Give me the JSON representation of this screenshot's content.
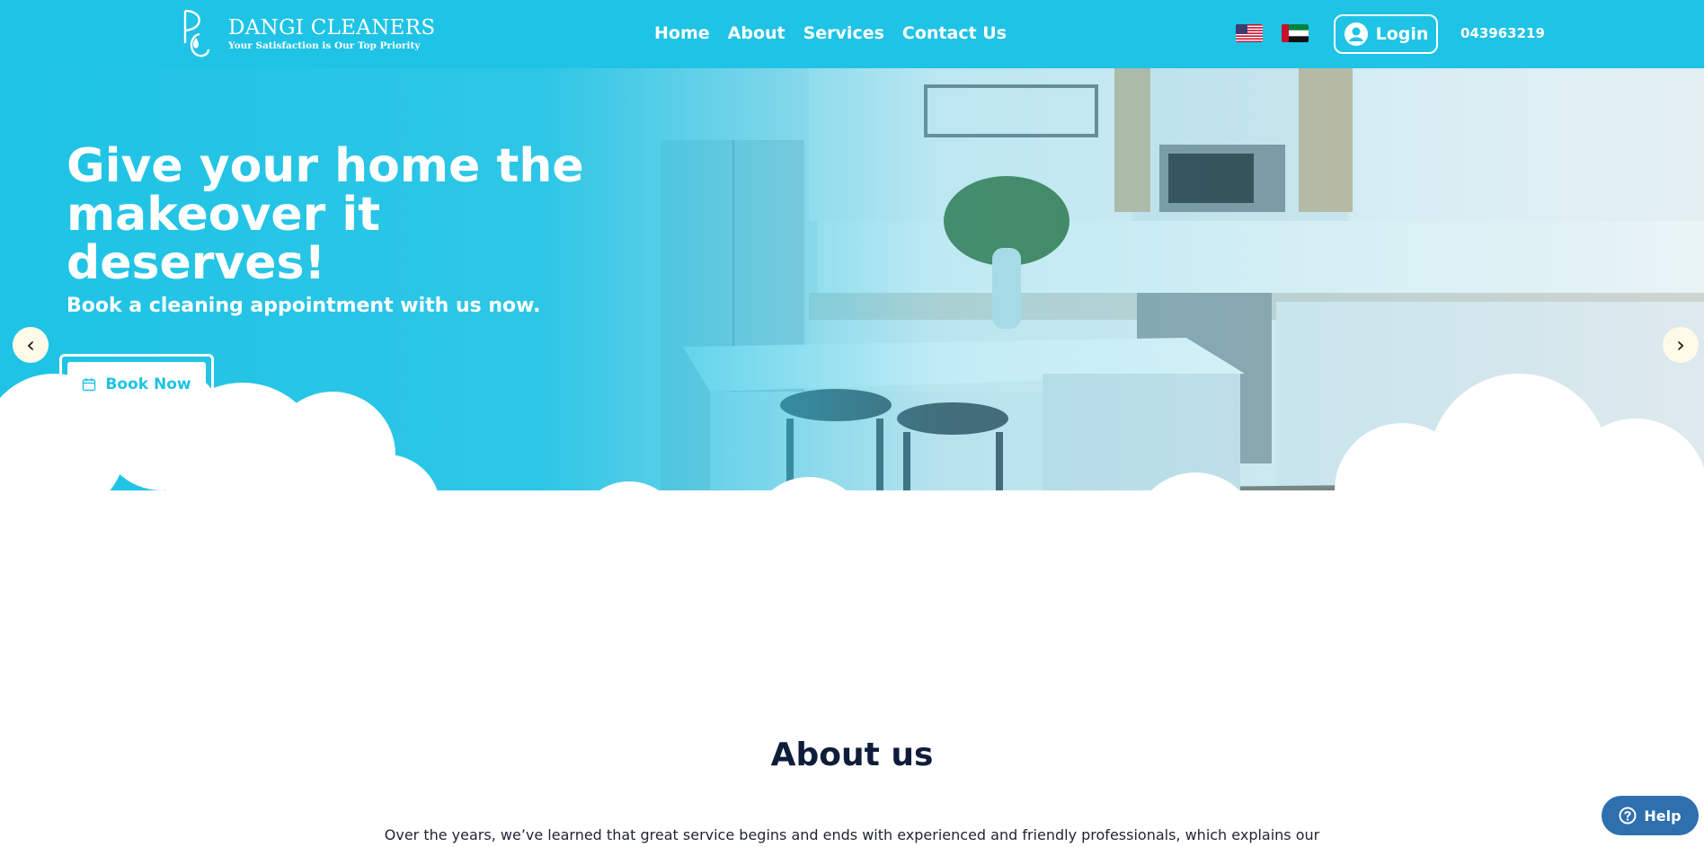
{
  "header": {
    "brand_name": "DANGI CLEANERS",
    "brand_tagline": "Your Satisfaction is Our Top Priority",
    "brand_monogram": "DC",
    "nav": [
      {
        "label": "Home"
      },
      {
        "label": "About"
      },
      {
        "label": "Services"
      },
      {
        "label": "Contact Us"
      }
    ],
    "flags": [
      "us-flag-icon",
      "uae-flag-icon"
    ],
    "login_label": "Login",
    "phone": "043963219"
  },
  "hero": {
    "title": "Give your home the makeover it deserves!",
    "subtitle": "Book a cleaning appointment with us now.",
    "book_label": "Book Now",
    "prev_glyph": "‹",
    "next_glyph": "›"
  },
  "about": {
    "title": "About us",
    "text": "Over the years, we’ve learned that great service begins and ends with experienced and friendly professionals, which explains our"
  },
  "help": {
    "label": "Help"
  },
  "colors": {
    "primary": "#1ec3e5",
    "heading": "#0f1d3b",
    "help": "#2e6fae"
  }
}
